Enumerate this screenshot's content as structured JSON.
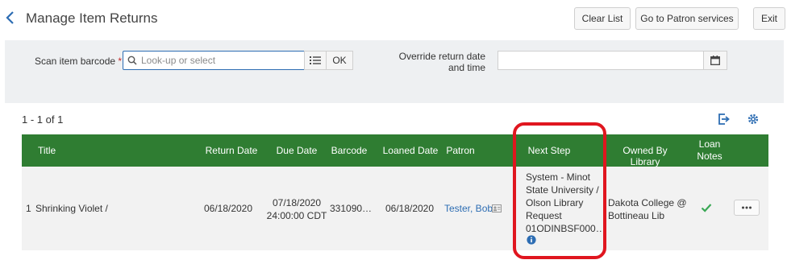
{
  "header": {
    "title": "Manage Item Returns",
    "buttons": {
      "clear": "Clear List",
      "patron": "Go to Patron services",
      "exit": "Exit"
    }
  },
  "scan": {
    "label": "Scan item barcode",
    "required_mark": "*",
    "placeholder": "Look-up or select",
    "ok": "OK",
    "override_label_1": "Override return date",
    "override_label_2": "and time"
  },
  "results": {
    "count": "1 - 1 of 1"
  },
  "table": {
    "columns": {
      "title": "Title",
      "return_date": "Return Date",
      "due_date": "Due Date",
      "barcode": "Barcode",
      "loaned_date": "Loaned Date",
      "patron": "Patron",
      "next_step": "Next Step",
      "owned_by": "Owned By Library",
      "loan_notes_1": "Loan",
      "loan_notes_2": "Notes"
    },
    "row": {
      "index": "1",
      "title": "Shrinking Violet /",
      "return_date": "06/18/2020",
      "due_date_1": "07/18/2020",
      "due_date_2": "24:00:00 CDT",
      "barcode": "331090…",
      "loaned_date": "06/18/2020",
      "patron": "Tester, Bob",
      "next_step_lines": [
        "System - Minot",
        "State University /",
        "Olson Library",
        "Request",
        "01ODINBSF000…"
      ],
      "owned_by_1": "Dakota College @",
      "owned_by_2": "Bottineau Lib"
    }
  },
  "colors": {
    "accent": "#2d6db3",
    "table_header": "#2f7d32",
    "highlight": "#e0161f",
    "check": "#3aa855"
  }
}
